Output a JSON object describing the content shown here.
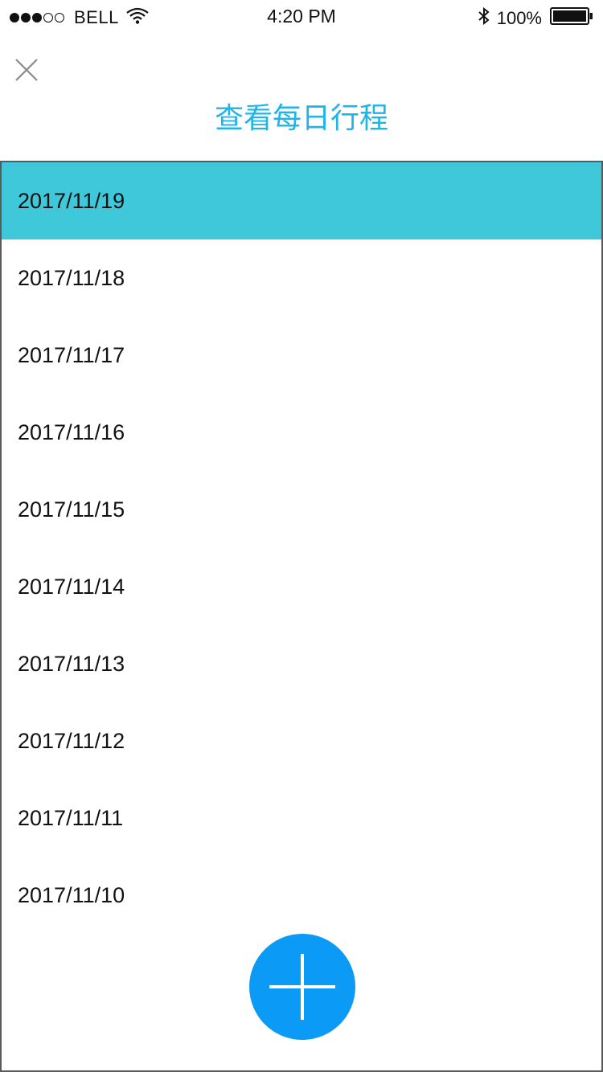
{
  "status_bar": {
    "signal_filled": 3,
    "signal_total": 5,
    "carrier": "BELL",
    "time": "4:20 PM",
    "battery_percent": "100%"
  },
  "header": {
    "title": "查看每日行程",
    "title_color": "#1fb5e9"
  },
  "icons": {
    "close": "close-icon",
    "add": "plus-icon",
    "wifi": "wifi-icon",
    "bluetooth": "bluetooth-icon",
    "battery": "battery-icon"
  },
  "list": {
    "selected_index": 0,
    "selected_color": "#3ec8da",
    "items": [
      {
        "label": "2017/11/19"
      },
      {
        "label": "2017/11/18"
      },
      {
        "label": "2017/11/17"
      },
      {
        "label": "2017/11/16"
      },
      {
        "label": "2017/11/15"
      },
      {
        "label": "2017/11/14"
      },
      {
        "label": "2017/11/13"
      },
      {
        "label": "2017/11/12"
      },
      {
        "label": "2017/11/11"
      },
      {
        "label": "2017/11/10"
      }
    ]
  },
  "fab": {
    "color": "#0b9af5"
  }
}
